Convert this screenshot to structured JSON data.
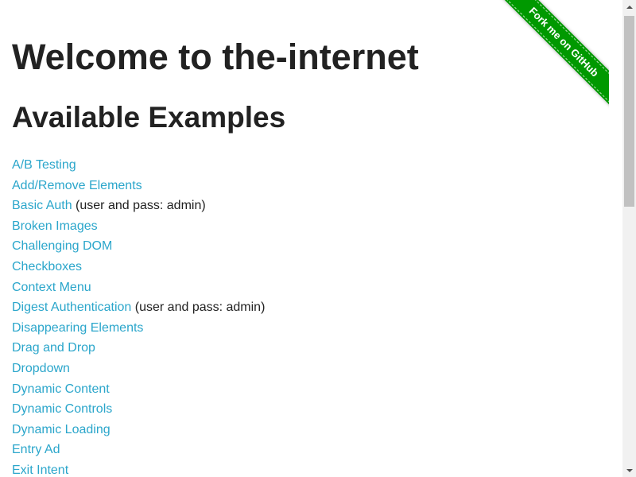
{
  "page": {
    "title": "Welcome to the-internet",
    "subtitle": "Available Examples"
  },
  "ribbon": {
    "label": "Fork me on GitHub",
    "color": "#009900"
  },
  "colors": {
    "link": "#2ba6cb",
    "text": "#222222"
  },
  "examples": [
    {
      "label": "A/B Testing",
      "note": ""
    },
    {
      "label": "Add/Remove Elements",
      "note": ""
    },
    {
      "label": "Basic Auth",
      "note": " (user and pass: admin)"
    },
    {
      "label": "Broken Images",
      "note": ""
    },
    {
      "label": "Challenging DOM",
      "note": ""
    },
    {
      "label": "Checkboxes",
      "note": ""
    },
    {
      "label": "Context Menu",
      "note": ""
    },
    {
      "label": "Digest Authentication",
      "note": " (user and pass: admin)"
    },
    {
      "label": "Disappearing Elements",
      "note": ""
    },
    {
      "label": "Drag and Drop",
      "note": ""
    },
    {
      "label": "Dropdown",
      "note": ""
    },
    {
      "label": "Dynamic Content",
      "note": ""
    },
    {
      "label": "Dynamic Controls",
      "note": ""
    },
    {
      "label": "Dynamic Loading",
      "note": ""
    },
    {
      "label": "Entry Ad",
      "note": ""
    },
    {
      "label": "Exit Intent",
      "note": ""
    }
  ]
}
